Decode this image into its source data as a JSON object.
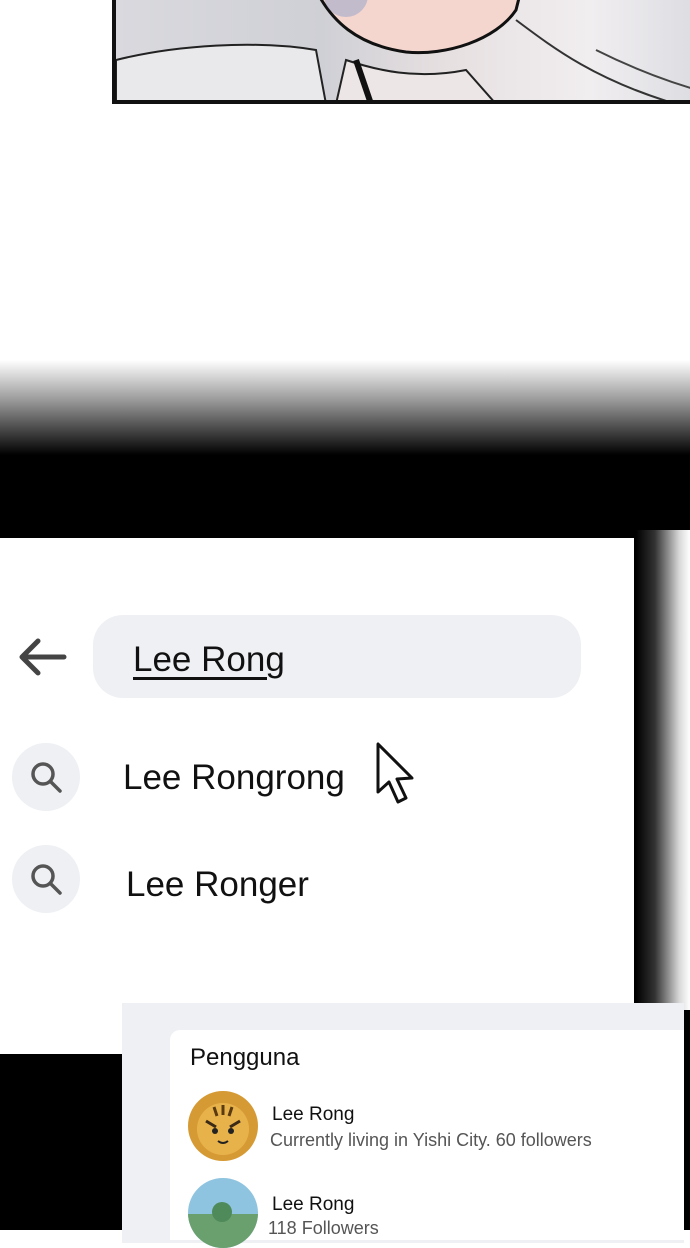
{
  "search": {
    "query": "Lee Rong"
  },
  "suggestions": [
    {
      "label": "Lee Rongrong",
      "icon": "search-icon"
    },
    {
      "label": "Lee Ronger",
      "icon": "search-icon"
    }
  ],
  "results": {
    "section_title": "Pengguna",
    "users": [
      {
        "name": "Lee Rong",
        "subtitle": "Currently living in Yishi City. 60 followers",
        "avatar": "avatar-tiger"
      },
      {
        "name": "Lee Rong",
        "subtitle": "118 Followers",
        "avatar": "avatar-landscape"
      }
    ]
  },
  "colors": {
    "field_bg": "#eff0f4",
    "text": "#111111",
    "subtext": "#555555"
  }
}
